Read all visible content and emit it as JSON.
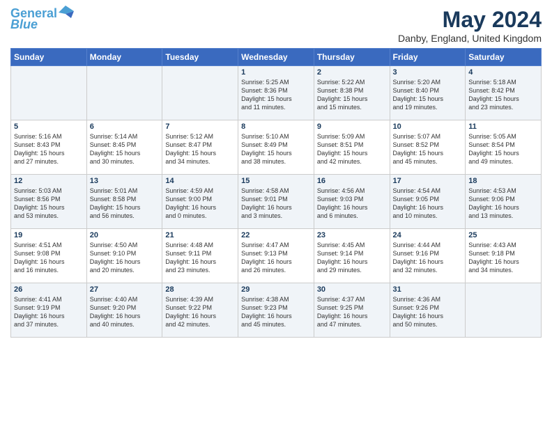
{
  "header": {
    "logo_line1": "General",
    "logo_line2": "Blue",
    "month_title": "May 2024",
    "location": "Danby, England, United Kingdom"
  },
  "weekdays": [
    "Sunday",
    "Monday",
    "Tuesday",
    "Wednesday",
    "Thursday",
    "Friday",
    "Saturday"
  ],
  "weeks": [
    [
      {
        "day": "",
        "info": ""
      },
      {
        "day": "",
        "info": ""
      },
      {
        "day": "",
        "info": ""
      },
      {
        "day": "1",
        "info": "Sunrise: 5:25 AM\nSunset: 8:36 PM\nDaylight: 15 hours\nand 11 minutes."
      },
      {
        "day": "2",
        "info": "Sunrise: 5:22 AM\nSunset: 8:38 PM\nDaylight: 15 hours\nand 15 minutes."
      },
      {
        "day": "3",
        "info": "Sunrise: 5:20 AM\nSunset: 8:40 PM\nDaylight: 15 hours\nand 19 minutes."
      },
      {
        "day": "4",
        "info": "Sunrise: 5:18 AM\nSunset: 8:42 PM\nDaylight: 15 hours\nand 23 minutes."
      }
    ],
    [
      {
        "day": "5",
        "info": "Sunrise: 5:16 AM\nSunset: 8:43 PM\nDaylight: 15 hours\nand 27 minutes."
      },
      {
        "day": "6",
        "info": "Sunrise: 5:14 AM\nSunset: 8:45 PM\nDaylight: 15 hours\nand 30 minutes."
      },
      {
        "day": "7",
        "info": "Sunrise: 5:12 AM\nSunset: 8:47 PM\nDaylight: 15 hours\nand 34 minutes."
      },
      {
        "day": "8",
        "info": "Sunrise: 5:10 AM\nSunset: 8:49 PM\nDaylight: 15 hours\nand 38 minutes."
      },
      {
        "day": "9",
        "info": "Sunrise: 5:09 AM\nSunset: 8:51 PM\nDaylight: 15 hours\nand 42 minutes."
      },
      {
        "day": "10",
        "info": "Sunrise: 5:07 AM\nSunset: 8:52 PM\nDaylight: 15 hours\nand 45 minutes."
      },
      {
        "day": "11",
        "info": "Sunrise: 5:05 AM\nSunset: 8:54 PM\nDaylight: 15 hours\nand 49 minutes."
      }
    ],
    [
      {
        "day": "12",
        "info": "Sunrise: 5:03 AM\nSunset: 8:56 PM\nDaylight: 15 hours\nand 53 minutes."
      },
      {
        "day": "13",
        "info": "Sunrise: 5:01 AM\nSunset: 8:58 PM\nDaylight: 15 hours\nand 56 minutes."
      },
      {
        "day": "14",
        "info": "Sunrise: 4:59 AM\nSunset: 9:00 PM\nDaylight: 16 hours\nand 0 minutes."
      },
      {
        "day": "15",
        "info": "Sunrise: 4:58 AM\nSunset: 9:01 PM\nDaylight: 16 hours\nand 3 minutes."
      },
      {
        "day": "16",
        "info": "Sunrise: 4:56 AM\nSunset: 9:03 PM\nDaylight: 16 hours\nand 6 minutes."
      },
      {
        "day": "17",
        "info": "Sunrise: 4:54 AM\nSunset: 9:05 PM\nDaylight: 16 hours\nand 10 minutes."
      },
      {
        "day": "18",
        "info": "Sunrise: 4:53 AM\nSunset: 9:06 PM\nDaylight: 16 hours\nand 13 minutes."
      }
    ],
    [
      {
        "day": "19",
        "info": "Sunrise: 4:51 AM\nSunset: 9:08 PM\nDaylight: 16 hours\nand 16 minutes."
      },
      {
        "day": "20",
        "info": "Sunrise: 4:50 AM\nSunset: 9:10 PM\nDaylight: 16 hours\nand 20 minutes."
      },
      {
        "day": "21",
        "info": "Sunrise: 4:48 AM\nSunset: 9:11 PM\nDaylight: 16 hours\nand 23 minutes."
      },
      {
        "day": "22",
        "info": "Sunrise: 4:47 AM\nSunset: 9:13 PM\nDaylight: 16 hours\nand 26 minutes."
      },
      {
        "day": "23",
        "info": "Sunrise: 4:45 AM\nSunset: 9:14 PM\nDaylight: 16 hours\nand 29 minutes."
      },
      {
        "day": "24",
        "info": "Sunrise: 4:44 AM\nSunset: 9:16 PM\nDaylight: 16 hours\nand 32 minutes."
      },
      {
        "day": "25",
        "info": "Sunrise: 4:43 AM\nSunset: 9:18 PM\nDaylight: 16 hours\nand 34 minutes."
      }
    ],
    [
      {
        "day": "26",
        "info": "Sunrise: 4:41 AM\nSunset: 9:19 PM\nDaylight: 16 hours\nand 37 minutes."
      },
      {
        "day": "27",
        "info": "Sunrise: 4:40 AM\nSunset: 9:20 PM\nDaylight: 16 hours\nand 40 minutes."
      },
      {
        "day": "28",
        "info": "Sunrise: 4:39 AM\nSunset: 9:22 PM\nDaylight: 16 hours\nand 42 minutes."
      },
      {
        "day": "29",
        "info": "Sunrise: 4:38 AM\nSunset: 9:23 PM\nDaylight: 16 hours\nand 45 minutes."
      },
      {
        "day": "30",
        "info": "Sunrise: 4:37 AM\nSunset: 9:25 PM\nDaylight: 16 hours\nand 47 minutes."
      },
      {
        "day": "31",
        "info": "Sunrise: 4:36 AM\nSunset: 9:26 PM\nDaylight: 16 hours\nand 50 minutes."
      },
      {
        "day": "",
        "info": ""
      }
    ]
  ]
}
